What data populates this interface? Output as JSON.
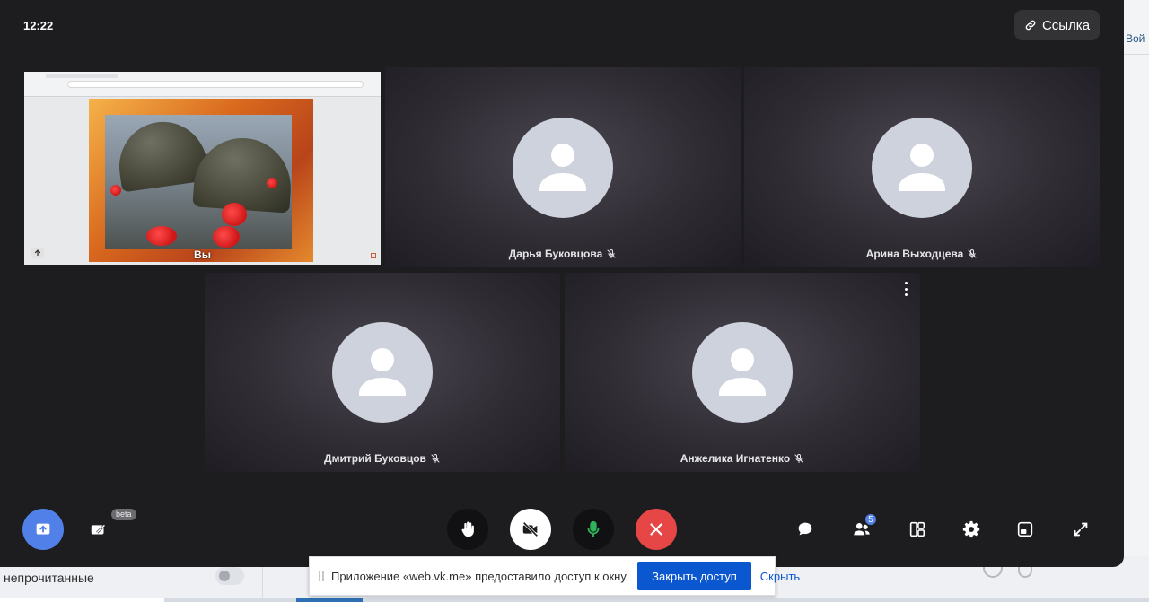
{
  "call": {
    "clock": "12:22",
    "link_button": "Ссылка"
  },
  "screen_share": {
    "caption": "Вы"
  },
  "participants": [
    {
      "name": "Дарья Буковцова",
      "muted": true
    },
    {
      "name": "Арина Выходцева",
      "muted": true
    },
    {
      "name": "Дмитрий Буковцов",
      "muted": true
    },
    {
      "name": "Анжелика Игнатенко",
      "muted": true
    }
  ],
  "controls": {
    "beta_label": "beta",
    "participants_count": "5"
  },
  "notification": {
    "message": "Приложение «web.vk.me» предоставило доступ к окну.",
    "close_access": "Закрыть доступ",
    "hide": "Скрыть"
  },
  "background_page": {
    "right_link": "Вой",
    "unread_label": "непрочитанные"
  },
  "colors": {
    "call_bg": "#1d1d1f",
    "accent_blue": "#5181e8",
    "end_call_red": "#e64646",
    "mic_green": "#2fb35a",
    "notice_button": "#0b57d0"
  }
}
